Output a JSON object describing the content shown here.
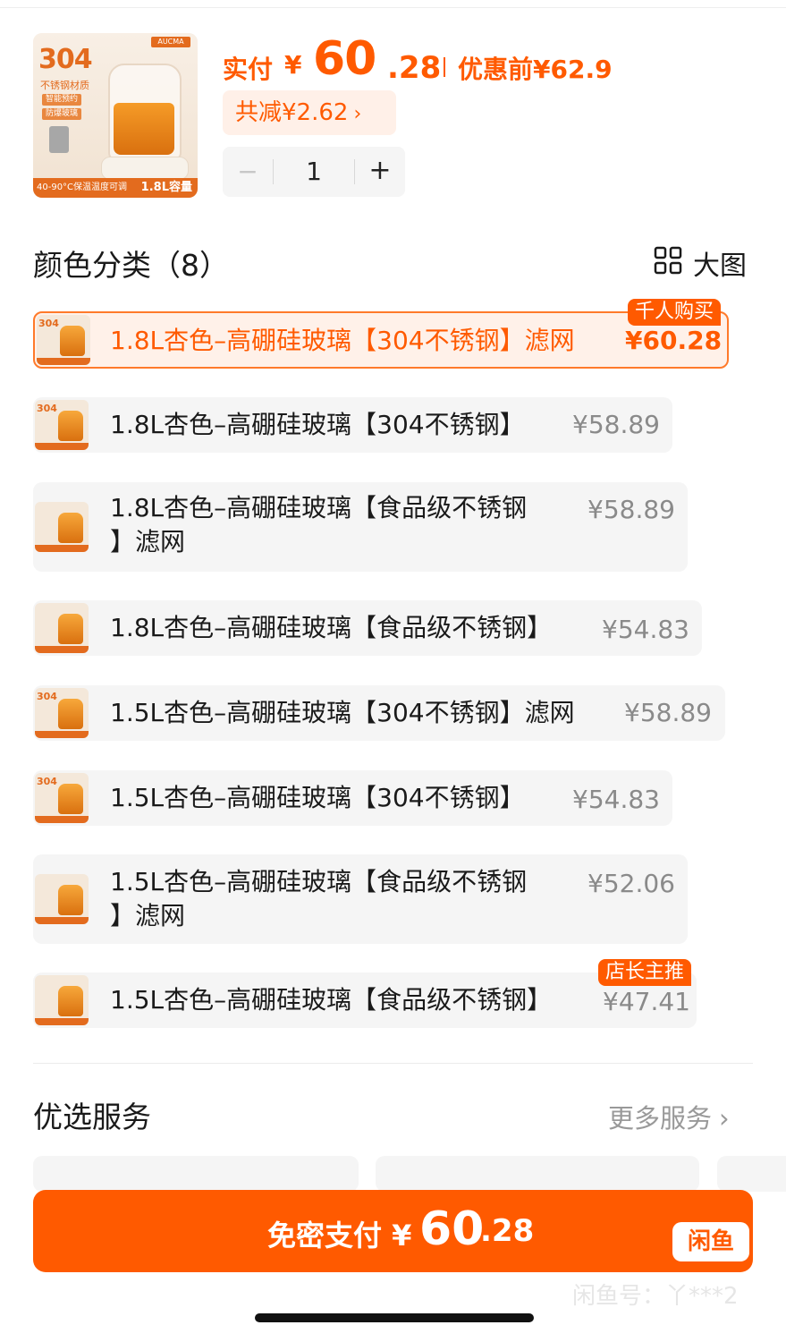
{
  "header": {
    "image": {
      "brand": "AUCMA",
      "badge_304": "304",
      "material": "不锈钢材质",
      "tags": [
        "智能预约",
        "防爆玻璃"
      ],
      "strip_left": "40-90°C保温温度可调",
      "strip_right": "1.8L容量"
    },
    "paid_label": "实付",
    "paid_yen": "¥",
    "paid_int": "60",
    "paid_dec": ".28",
    "original_price": "优惠前¥62.9",
    "discount": "共减¥2.62",
    "quantity": "1",
    "minus": "−",
    "plus": "+"
  },
  "section": {
    "title": "颜色分类（8）",
    "big_view": "大图"
  },
  "options": [
    {
      "label": "1.8L杏色–高硼硅玻璃【304不锈钢】滤网",
      "price": "¥60.28",
      "badge": "千人购买",
      "selected": true
    },
    {
      "label": "1.8L杏色–高硼硅玻璃【304不锈钢】",
      "price": "¥58.89"
    },
    {
      "label": "1.8L杏色–高硼硅玻璃【食品级不锈钢",
      "label2": "】滤网",
      "price": "¥58.89"
    },
    {
      "label": "1.8L杏色–高硼硅玻璃【食品级不锈钢】",
      "price": "¥54.83"
    },
    {
      "label": "1.5L杏色–高硼硅玻璃【304不锈钢】滤网",
      "price": "¥58.89"
    },
    {
      "label": "1.5L杏色–高硼硅玻璃【304不锈钢】",
      "price": "¥54.83"
    },
    {
      "label": "1.5L杏色–高硼硅玻璃【食品级不锈钢",
      "label2": "】滤网",
      "price": "¥52.06"
    },
    {
      "label": "1.5L杏色–高硼硅玻璃【食品级不锈钢】",
      "price": "¥47.41",
      "badge": "店长主推"
    }
  ],
  "services": {
    "title": "优选服务",
    "more": "更多服务",
    "chevron": "›"
  },
  "pay": {
    "label": "免密支付 ¥",
    "int": "60",
    "dec": ".28",
    "logo": "闲鱼"
  },
  "watermark": "闲鱼号：丫***2",
  "colors": {
    "accent": "#ff5a00",
    "selected_bg": "#fff1e9",
    "row_bg": "#f5f5f5"
  }
}
